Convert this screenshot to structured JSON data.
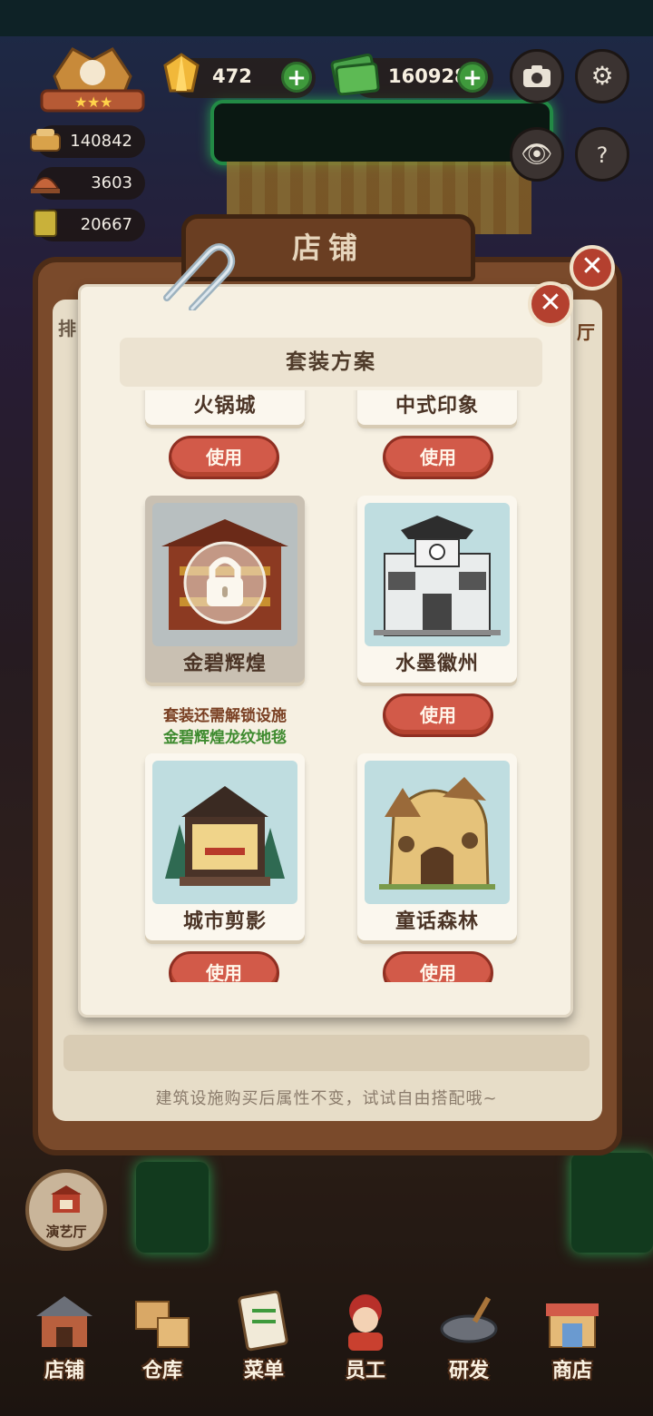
{
  "hud": {
    "gem_count": "472",
    "cash_count": "160928",
    "res1": "140842",
    "res2": "3603",
    "res3": "20667"
  },
  "shop": {
    "title": "店铺",
    "bottom_hint": "建筑设施购买后属性不变，试试自由搭配哦~",
    "peek_left": "排",
    "peek_right": "厅"
  },
  "dialog": {
    "title": "套装方案",
    "top_row": [
      {
        "name": "火锅城",
        "use_label": "使用"
      },
      {
        "name": "中式印象",
        "use_label": "使用"
      }
    ],
    "items": [
      {
        "name": "金碧辉煌",
        "locked": true
      },
      {
        "name": "水墨徽州",
        "locked": false,
        "use_label": "使用"
      },
      {
        "name": "城市剪影",
        "locked": false,
        "use_label": "使用"
      },
      {
        "name": "童话森林",
        "locked": false,
        "use_label": "使用"
      }
    ],
    "lock_note_line1": "套装还需解锁设施",
    "lock_note_line2": "金碧辉煌龙纹地毯"
  },
  "theater": {
    "label": "演艺厅"
  },
  "nav": [
    {
      "label": "店铺"
    },
    {
      "label": "仓库"
    },
    {
      "label": "菜单"
    },
    {
      "label": "员工"
    },
    {
      "label": "研发"
    },
    {
      "label": "商店"
    }
  ]
}
